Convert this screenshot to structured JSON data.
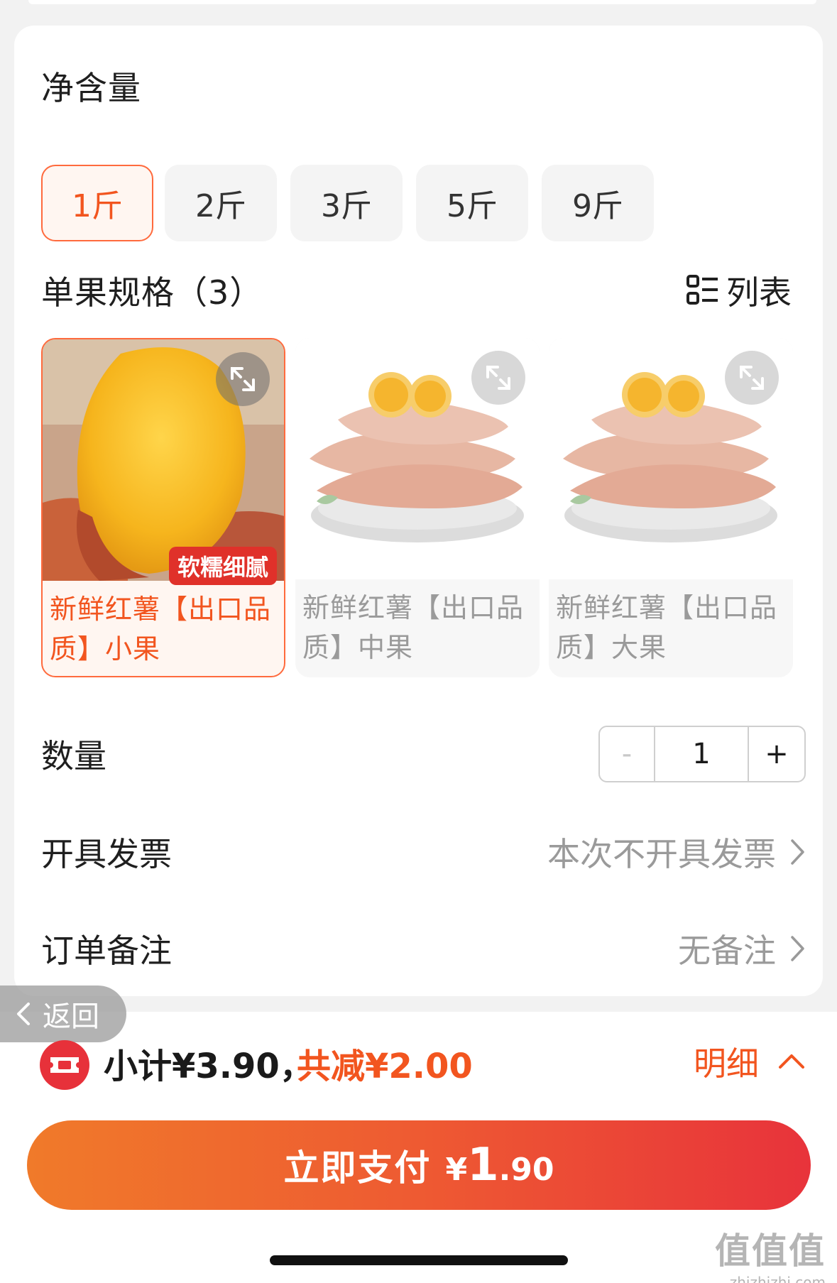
{
  "net_weight": {
    "title": "净含量",
    "options": [
      "1斤",
      "2斤",
      "3斤",
      "5斤",
      "9斤"
    ],
    "selected": "1斤"
  },
  "spec": {
    "title": "单果规格（3）",
    "view_toggle": "列表",
    "items": [
      {
        "label": "新鲜红薯【出口品质】小果",
        "badge": "软糯细腻",
        "selected": true
      },
      {
        "label": "新鲜红薯【出口品质】中果",
        "selected": false
      },
      {
        "label": "新鲜红薯【出口品质】大果",
        "selected": false
      }
    ]
  },
  "quantity": {
    "label": "数量",
    "minus": "-",
    "value": "1",
    "plus": "+"
  },
  "invoice": {
    "label": "开具发票",
    "value": "本次不开具发票"
  },
  "remark": {
    "label": "订单备注",
    "value": "无备注"
  },
  "back": {
    "label": "返回"
  },
  "summary": {
    "subtotal": "小计¥3.90，",
    "discount": "共减¥2.00",
    "detail": "明细"
  },
  "pay": {
    "label": "立即支付",
    "currency": "¥",
    "price_int": "1",
    "price_dec": ".90"
  },
  "watermark": {
    "main": "值值值",
    "sub": "zhizhizhi.com"
  },
  "colors": {
    "accent": "#f2551f",
    "badge": "#e0312a",
    "pay_start": "#f07a2a",
    "pay_end": "#e8333b"
  }
}
